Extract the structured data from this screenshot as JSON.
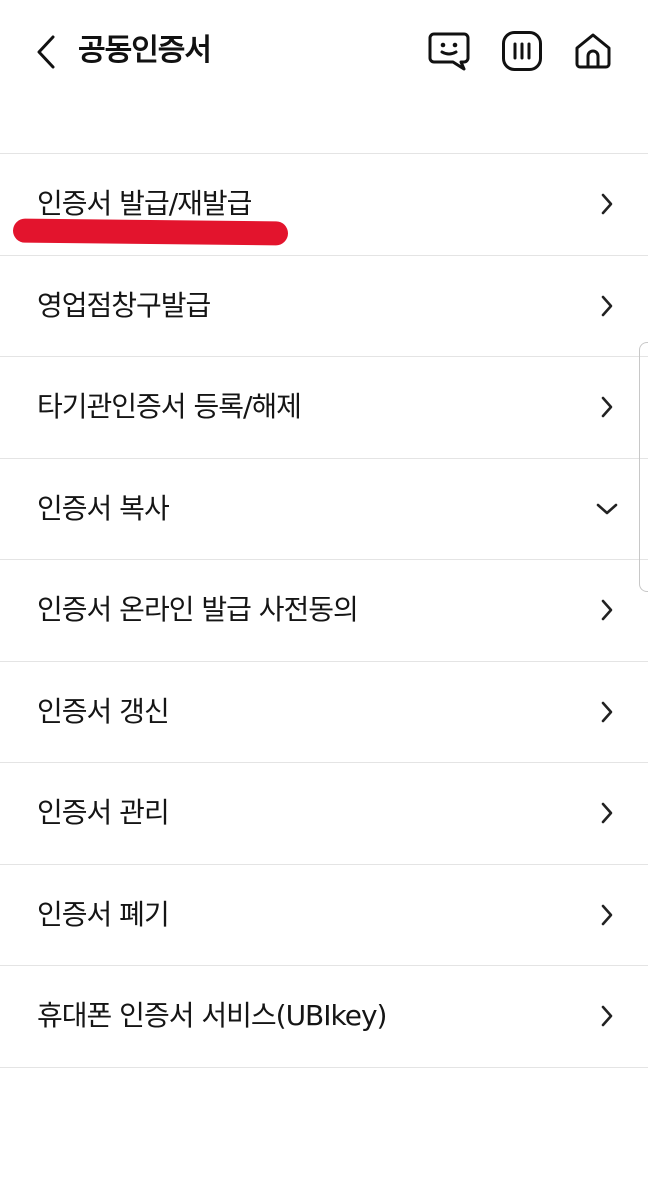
{
  "header": {
    "title": "공동인증서",
    "back_icon": "chevron-left-icon",
    "actions": [
      {
        "name": "chatbot-icon"
      },
      {
        "name": "menu-icon"
      },
      {
        "name": "home-icon"
      }
    ]
  },
  "menu": {
    "items": [
      {
        "label": "인증서 발급/재발급",
        "icon": "chevron-right-icon"
      },
      {
        "label": "영업점창구발급",
        "icon": "chevron-right-icon"
      },
      {
        "label": "타기관인증서 등록/해제",
        "icon": "chevron-right-icon"
      },
      {
        "label": "인증서 복사",
        "icon": "chevron-down-icon"
      },
      {
        "label": "인증서 온라인 발급 사전동의",
        "icon": "chevron-right-icon"
      },
      {
        "label": "인증서 갱신",
        "icon": "chevron-right-icon"
      },
      {
        "label": "인증서 관리",
        "icon": "chevron-right-icon"
      },
      {
        "label": "인증서 폐기",
        "icon": "chevron-right-icon"
      },
      {
        "label": "휴대폰 인증서 서비스(UBIkey)",
        "icon": "chevron-right-icon"
      }
    ]
  },
  "colors": {
    "highlight": "#e3142d",
    "divider": "#e4e4e4",
    "text": "#151515"
  }
}
